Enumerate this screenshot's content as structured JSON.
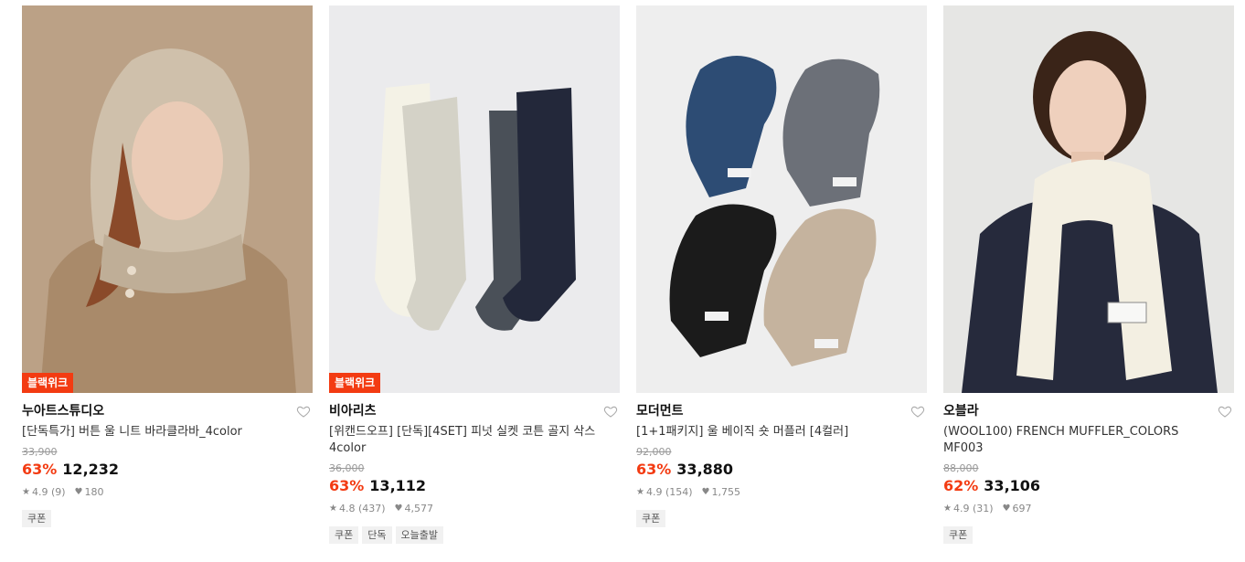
{
  "products": [
    {
      "badge": "블랙위크",
      "brand": "누아트스튜디오",
      "title": "[단독특가] 버튼 울 니트 바라클라바_4color",
      "original_price": "33,900",
      "discount": "63%",
      "price": "12,232",
      "rating": "4.9 (9)",
      "likes": "180",
      "tags": [
        "쿠폰"
      ],
      "image_icon": "woman-knit-balaclava-photo"
    },
    {
      "badge": "블랙위크",
      "brand": "비아리츠",
      "title": "[위캔드오프] [단독][4SET] 피넛 실켓 코튼 골지 삭스 4color",
      "original_price": "36,000",
      "discount": "63%",
      "price": "13,112",
      "rating": "4.8 (437)",
      "likes": "4,577",
      "tags": [
        "쿠폰",
        "단독",
        "오늘출발"
      ],
      "image_icon": "ribbed-socks-photo"
    },
    {
      "badge": "",
      "brand": "모더먼트",
      "title": "[1+1패키지] 울 베이직 숏 머플러 [4컬러]",
      "original_price": "92,000",
      "discount": "63%",
      "price": "33,880",
      "rating": "4.9 (154)",
      "likes": "1,755",
      "tags": [
        "쿠폰"
      ],
      "image_icon": "short-mufflers-photo"
    },
    {
      "badge": "",
      "brand": "오블라",
      "title": "(WOOL100) FRENCH MUFFLER_COLORS MF003",
      "original_price": "88,000",
      "discount": "62%",
      "price": "33,106",
      "rating": "4.9 (31)",
      "likes": "697",
      "tags": [
        "쿠폰"
      ],
      "image_icon": "woman-white-muffler-photo"
    }
  ],
  "colors": {
    "accent": "#f33b12",
    "muted": "#888888"
  }
}
